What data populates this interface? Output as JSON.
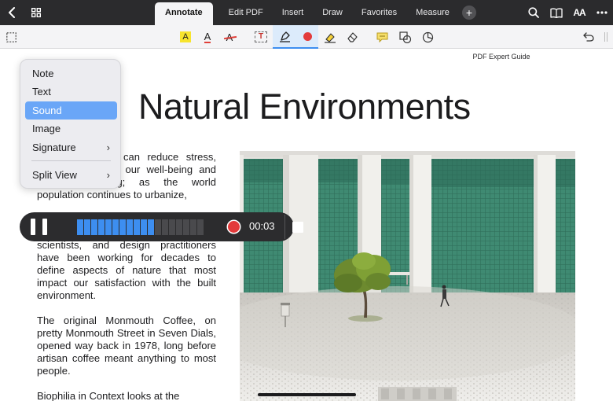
{
  "tabs": [
    {
      "label": "Annotate",
      "active": true
    },
    {
      "label": "Edit PDF",
      "active": false
    },
    {
      "label": "Insert",
      "active": false
    },
    {
      "label": "Draw",
      "active": false
    },
    {
      "label": "Favorites",
      "active": false
    },
    {
      "label": "Measure",
      "active": false
    }
  ],
  "header": {
    "add_tab_glyph": "+",
    "text_size_label": "AA"
  },
  "toolbar": {
    "text_tool_label": "T",
    "highlight_letter": "A",
    "underline_letter": "A",
    "strike_letter": "A"
  },
  "document": {
    "name": "PDF Expert Guide",
    "heading": "Natural Environments",
    "paragraphs": [
      "can reduce stress, ity and clarity of our well-being and expedite healing; as the world population continues to urbanize,",
      "scientists, and design practitioners have been working for decades to define aspects of nature that most impact our satisfaction with the built environment.",
      "The original Monmouth Coffee, on pretty Monmouth Street in Seven Dials, opened way back in 1978, long before artisan coffee meant anything to most people.",
      "Biophilia in Context looks at the"
    ]
  },
  "menu": {
    "items": [
      {
        "label": "Note",
        "has_submenu": false,
        "active": false
      },
      {
        "label": "Text",
        "has_submenu": false,
        "active": false
      },
      {
        "label": "Sound",
        "has_submenu": false,
        "active": true
      },
      {
        "label": "Image",
        "has_submenu": false,
        "active": false
      },
      {
        "label": "Signature",
        "has_submenu": true,
        "active": false
      },
      {
        "label": "Split View",
        "has_submenu": true,
        "active": false
      }
    ],
    "submenu_glyph": "›"
  },
  "recorder": {
    "time": "00:03",
    "level_filled": 11,
    "level_total": 18
  },
  "colors": {
    "accent": "#3d8ef0",
    "record": "#e33b3b",
    "topbar": "#2b2b2d",
    "menu_highlight": "#6aa6f7"
  },
  "icons": [
    "back-chevron-icon",
    "grid-icon",
    "search-icon",
    "book-icon",
    "text-size-icon",
    "more-icon",
    "selection-icon",
    "highlight-text-icon",
    "underline-text-icon",
    "strikethrough-icon",
    "text-box-icon",
    "pen-icon",
    "color-dot-icon",
    "highlighter-icon",
    "eraser-icon",
    "comment-icon",
    "shapes-icon",
    "stamp-icon",
    "undo-icon",
    "sidebar-handle-icon",
    "pause-icon",
    "record-icon",
    "stop-icon"
  ]
}
